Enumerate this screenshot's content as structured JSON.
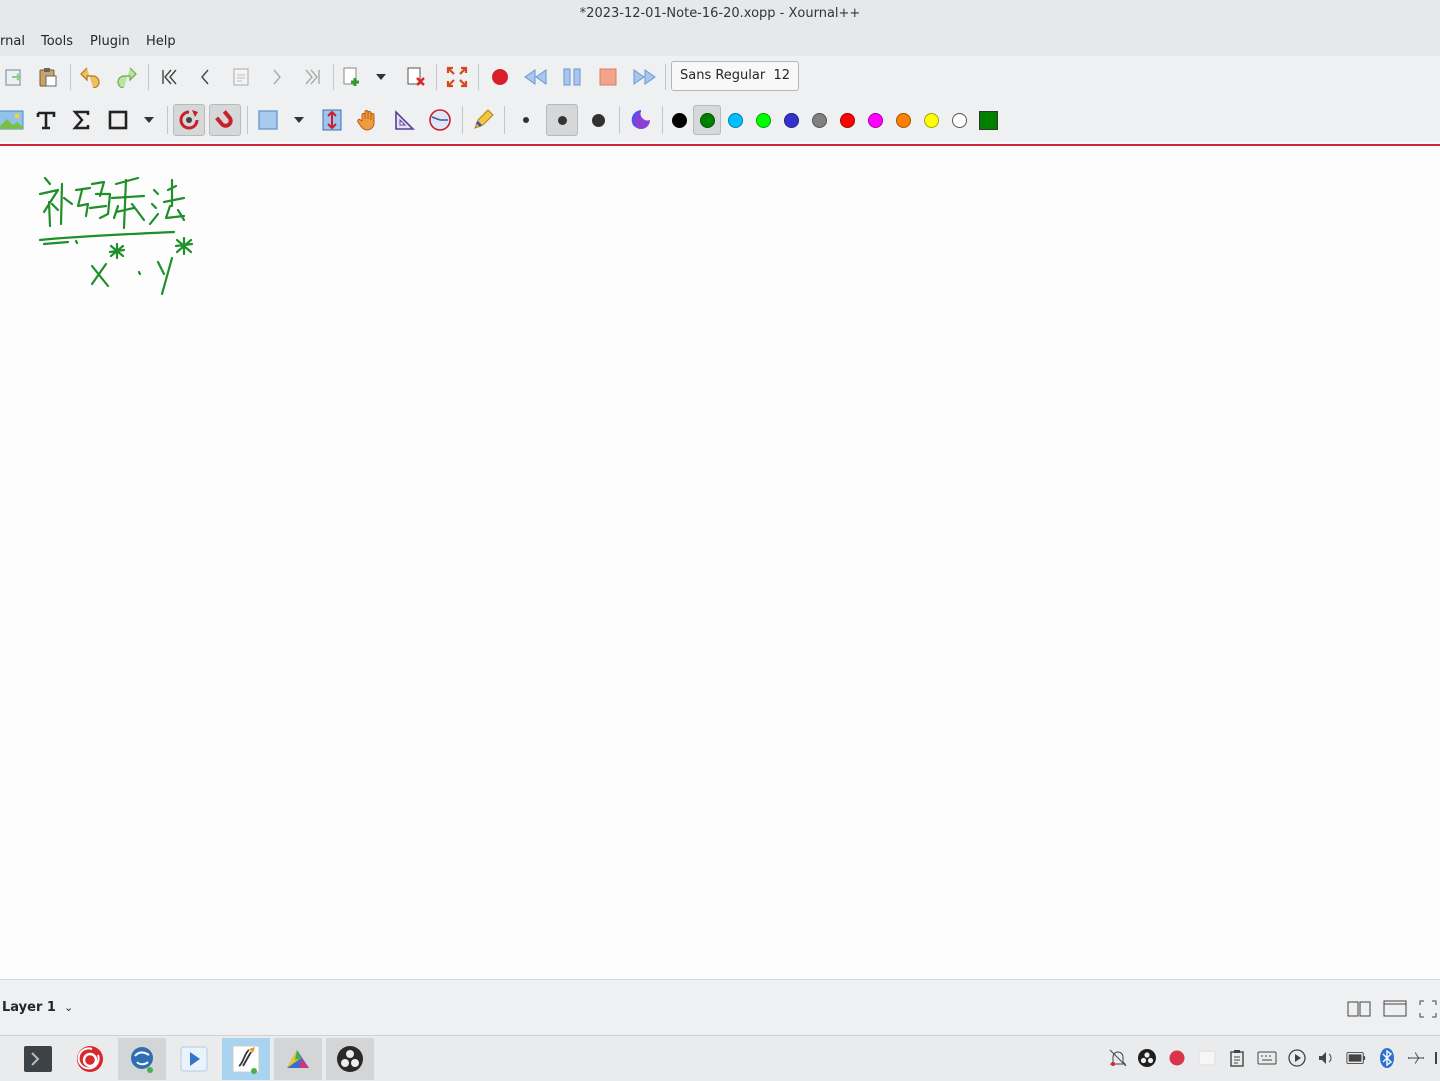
{
  "window": {
    "title": "*2023-12-01-Note-16-20.xopp - Xournal++"
  },
  "menu": {
    "items": [
      "rnal",
      "Tools",
      "Plugin",
      "Help"
    ]
  },
  "font_selector": {
    "name": "Sans Regular",
    "size": "12"
  },
  "colors": {
    "palette": [
      "#000000",
      "#008000",
      "#00c0ff",
      "#00ff00",
      "#3333cc",
      "#808080",
      "#ff0000",
      "#ff00ff",
      "#ff8000",
      "#ffff00",
      "#ffffff"
    ],
    "selected": "#008000",
    "ink": "#1f8f2a",
    "accent_line": "#c8283c"
  },
  "icons": {
    "toolbar1": [
      "paste-icon",
      "clipboard-icon",
      "undo-icon",
      "redo-icon",
      "first-page-icon",
      "previous-page-icon",
      "goto-page-icon",
      "next-page-icon",
      "last-page-icon",
      "new-page-icon",
      "delete-page-icon",
      "fullscreen-icon",
      "record-icon",
      "rewind-icon",
      "pause-icon",
      "stop-icon",
      "fast-forward-icon"
    ],
    "toolbar2": [
      "image-icon",
      "text-icon",
      "math-tex-icon",
      "shape-rectangle-icon",
      "shape-recognizer-icon",
      "snap-magnet-icon",
      "select-rectangle-icon",
      "vertical-space-icon",
      "hand-icon",
      "setsquare-icon",
      "compass-icon",
      "default-tools-icon",
      "thin-point-icon",
      "medium-point-icon",
      "thick-point-icon",
      "custom-color-icon"
    ]
  },
  "canvas": {
    "handwriting": "补码乘法 x*·y*"
  },
  "status": {
    "layer": "Layer 1"
  },
  "taskbar": {
    "apps": [
      "terminal-app-icon",
      "netease-music-app-icon",
      "xfce-settings-app-icon",
      "media-player-app-icon",
      "xournal-app-icon",
      "geogebra-app-icon",
      "obs-app-icon"
    ]
  }
}
